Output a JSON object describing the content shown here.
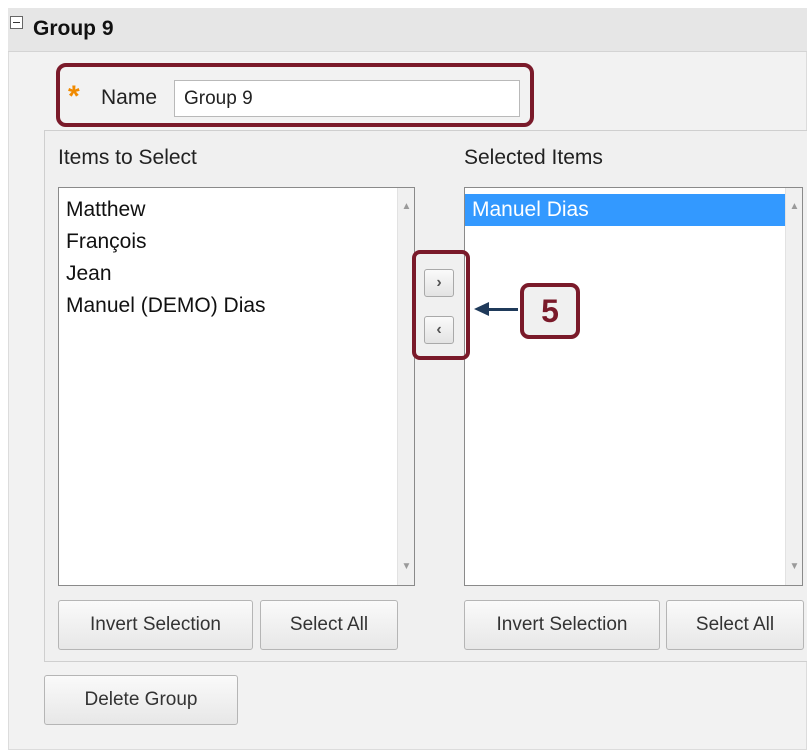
{
  "group": {
    "title": "Group 9"
  },
  "name_field": {
    "label": "Name",
    "value": "Group 9",
    "required_marker": "*"
  },
  "items_to_select": {
    "title": "Items to Select",
    "items": [
      "Matthew",
      "François",
      "Jean",
      "Manuel (DEMO) Dias"
    ],
    "invert_label": "Invert Selection",
    "select_all_label": "Select All"
  },
  "selected_items": {
    "title": "Selected Items",
    "items": [
      "Manuel Dias"
    ],
    "invert_label": "Invert Selection",
    "select_all_label": "Select All"
  },
  "move_buttons": {
    "right_symbol": "›",
    "left_symbol": "‹"
  },
  "callout": {
    "step_number": "5"
  },
  "delete_button_label": "Delete Group",
  "colors": {
    "highlight": "#7a1a2a",
    "selection": "#3399ff",
    "required_star": "#f08a00",
    "arrow": "#1f3a5a"
  }
}
